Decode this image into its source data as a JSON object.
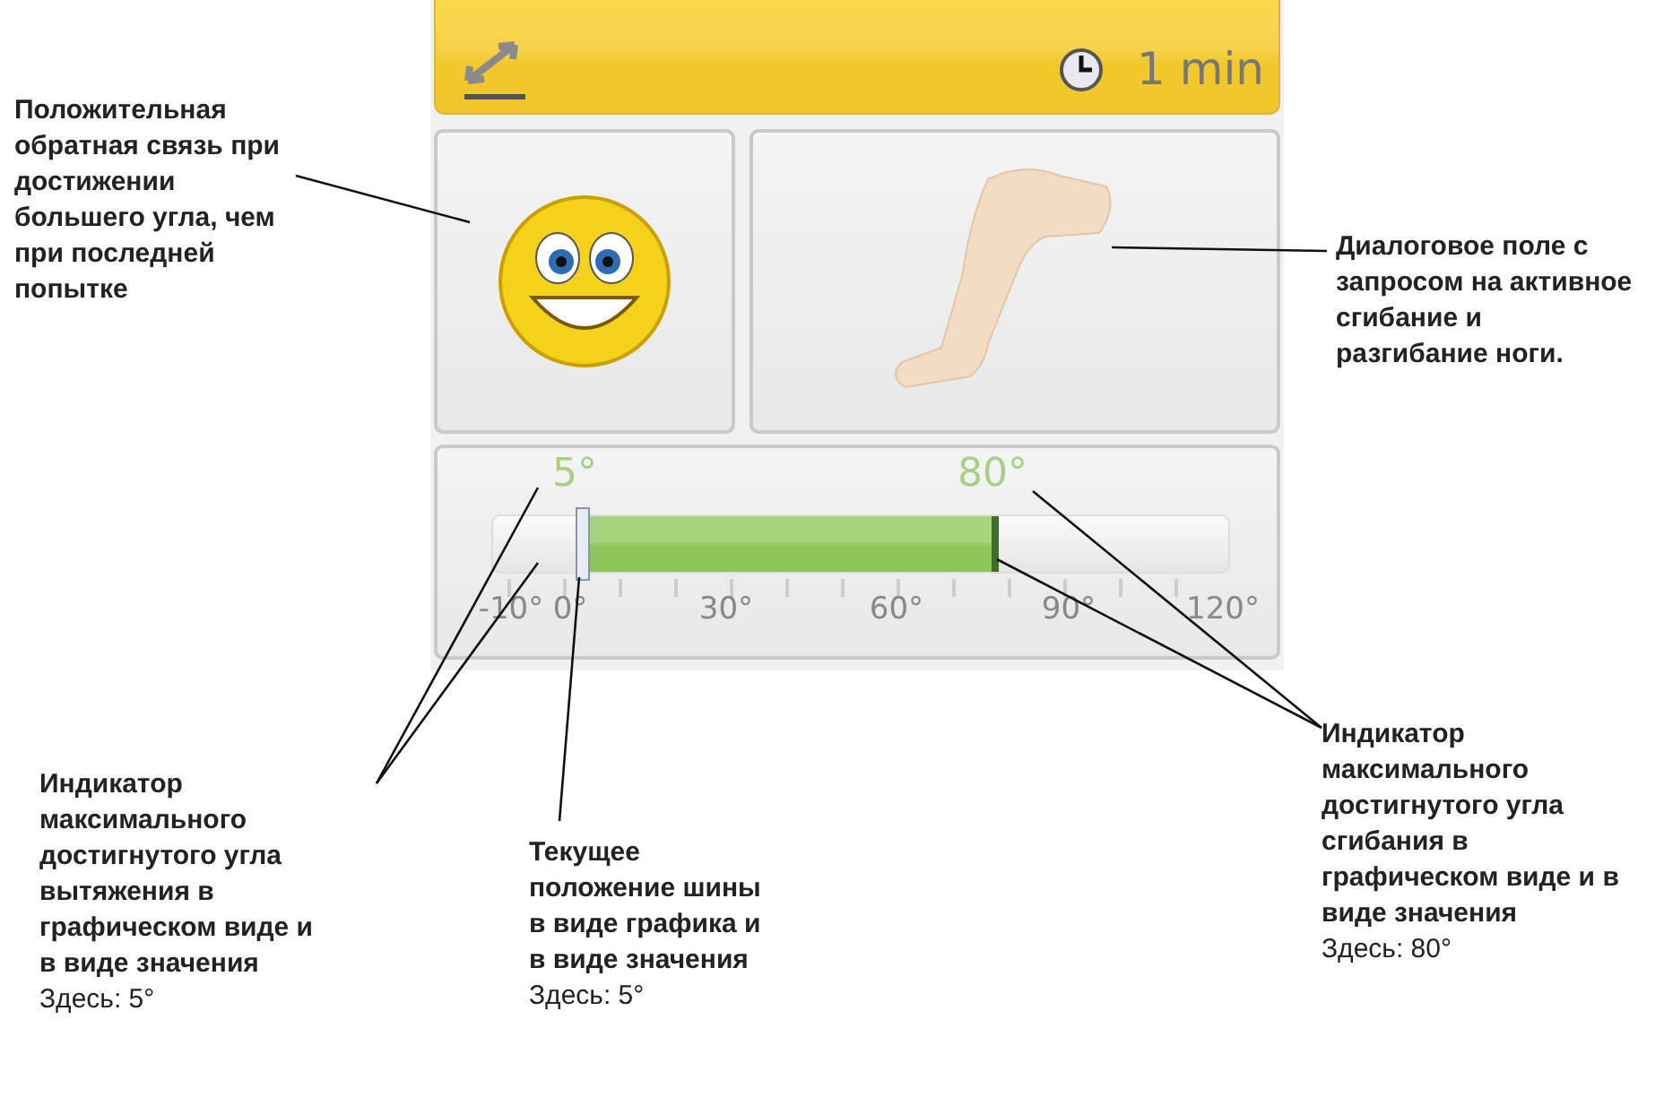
{
  "header": {
    "duration": "1 min"
  },
  "gauge": {
    "extension_label": "5°",
    "flexion_label": "80°",
    "current": {
      "level": 0.114
    },
    "flexion_max": {
      "level": 0.685
    },
    "scale": [
      "-10°",
      "0°",
      "30°",
      "60°",
      "90°",
      "120°"
    ]
  },
  "callouts": [
    {
      "title": "Положительная обратная связь при достижении большего угла, чем при последней попытке"
    },
    {
      "title": "Диалоговое поле с запросом на активное сгибание и разгибание ноги."
    },
    {
      "title": "Индикатор максимального достигнутого угла вытяжения в графическом виде и в виде значения",
      "note": "Здесь: 5°"
    },
    {
      "title": "Текущее положение шины в виде графика и в виде значения",
      "note": "Здесь: 5°"
    },
    {
      "title": "Индикатор максимального достигнутого угла сгибания в графическом виде и в виде значения",
      "note": "Здесь: 80°"
    }
  ]
}
